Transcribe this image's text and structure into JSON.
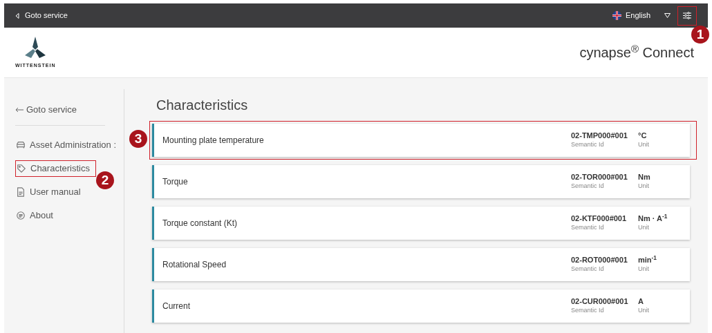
{
  "top_bar": {
    "back_link": "Goto service",
    "language": "English",
    "settings_button": {
      "callout": "1"
    }
  },
  "header": {
    "logo_text": "WITTENSTEIN",
    "product": "cynapse$^{®}$ Connect"
  },
  "sidebar": {
    "back_link": "Goto service",
    "items": [
      {
        "kind": "car",
        "label": "Asset Administration :"
      },
      {
        "kind": "tag",
        "label": "Characteristics",
        "callout": "2"
      },
      {
        "kind": "document",
        "label": "User manual"
      },
      {
        "kind": "chat",
        "label": "About"
      }
    ]
  },
  "main": {
    "title": "Characteristics",
    "cards": [
      {
        "name": "Mounting plate temperature",
        "semantic_id": "02-TMP000#001",
        "semantic_label": "Semantic Id",
        "unit": "°C",
        "unit_label": "Unit",
        "callout": "3"
      },
      {
        "name": "Torque",
        "semantic_id": "02-TOR000#001",
        "semantic_label": "Semantic Id",
        "unit": "Nm",
        "unit_label": "Unit"
      },
      {
        "name": "Torque constant (Kt)",
        "semantic_id": "02-KTF000#001",
        "semantic_label": "Semantic Id",
        "unit": "Nm · A$^{-1}$",
        "unit_label": "Unit"
      },
      {
        "name": "Rotational Speed",
        "semantic_id": "02-ROT000#001",
        "semantic_label": "Semantic Id",
        "unit": "min$^{-1}$",
        "unit_label": "Unit"
      },
      {
        "name": "Current",
        "semantic_id": "02-CUR000#001",
        "semantic_label": "Semantic Id",
        "unit": "A",
        "unit_label": "Unit"
      }
    ]
  }
}
